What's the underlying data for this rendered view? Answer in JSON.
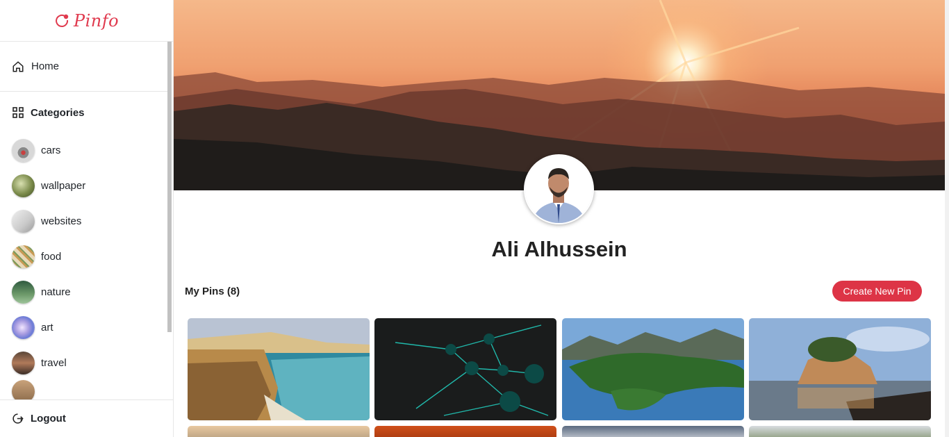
{
  "app": {
    "logo_text": "Pinfo",
    "brand_color": "#e03a4e"
  },
  "sidebar": {
    "home_label": "Home",
    "categories_title": "Categories",
    "categories": [
      {
        "label": "cars",
        "thumb": "cars-thumbnail"
      },
      {
        "label": "wallpaper",
        "thumb": "wallpaper-thumbnail"
      },
      {
        "label": "websites",
        "thumb": "websites-thumbnail"
      },
      {
        "label": "food",
        "thumb": "food-thumbnail"
      },
      {
        "label": "nature",
        "thumb": "nature-thumbnail"
      },
      {
        "label": "art",
        "thumb": "art-thumbnail"
      },
      {
        "label": "travel",
        "thumb": "travel-thumbnail"
      }
    ],
    "logout_label": "Logout"
  },
  "profile": {
    "name": "Ali Alhussein",
    "pins_label": "My Pins (8)",
    "create_button": "Create New Pin",
    "accent_color": "#dd3446"
  },
  "pins": [
    {
      "subject": "coastal cliffs and ocean"
    },
    {
      "subject": "network nodes"
    },
    {
      "subject": "island lake landscape"
    },
    {
      "subject": "rock island at sunset"
    },
    {
      "subject": "sunset sky"
    },
    {
      "subject": "orange abstract"
    },
    {
      "subject": "cloudy sky"
    },
    {
      "subject": "landscape"
    }
  ]
}
